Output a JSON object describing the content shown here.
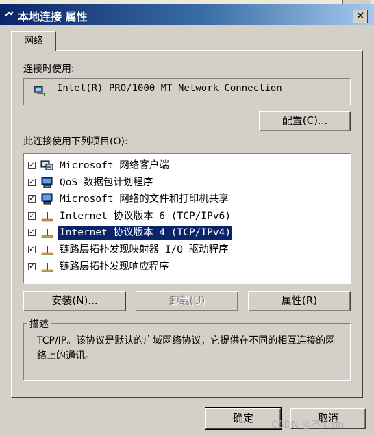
{
  "window": {
    "title": "本地连接 属性"
  },
  "tab": {
    "label": "网络"
  },
  "connect_using": {
    "label": "连接时使用:",
    "adapter": "Intel(R) PRO/1000 MT Network Connection"
  },
  "configure_button": "配置(C)...",
  "items_label": "此连接使用下列项目(O):",
  "items": [
    {
      "label": "Microsoft 网络客户端",
      "checked": true,
      "icon": "network-client-icon"
    },
    {
      "label": "QoS 数据包计划程序",
      "checked": true,
      "icon": "computer-service-icon"
    },
    {
      "label": "Microsoft 网络的文件和打印机共享",
      "checked": true,
      "icon": "computer-service-icon"
    },
    {
      "label": "Internet 协议版本 6 (TCP/IPv6)",
      "checked": true,
      "icon": "protocol-icon"
    },
    {
      "label": "Internet 协议版本 4 (TCP/IPv4)",
      "checked": true,
      "icon": "protocol-icon",
      "selected": true
    },
    {
      "label": "链路层拓扑发现映射器 I/O 驱动程序",
      "checked": true,
      "icon": "protocol-icon"
    },
    {
      "label": "链路层拓扑发现响应程序",
      "checked": true,
      "icon": "protocol-icon"
    }
  ],
  "buttons": {
    "install": "安装(N)...",
    "uninstall": "卸载(U)",
    "properties": "属性(R)",
    "ok": "确定",
    "cancel": "取消"
  },
  "description": {
    "legend": "描述",
    "text": "TCP/IP。该协议是默认的广域网络协议，它提供在不同的相互连接的网络上的通讯。"
  },
  "watermark": "CSDN @不多sin",
  "colors": {
    "selection": "#0a246a",
    "titlebar": "#0a246a",
    "face": "#d4d0c8"
  }
}
